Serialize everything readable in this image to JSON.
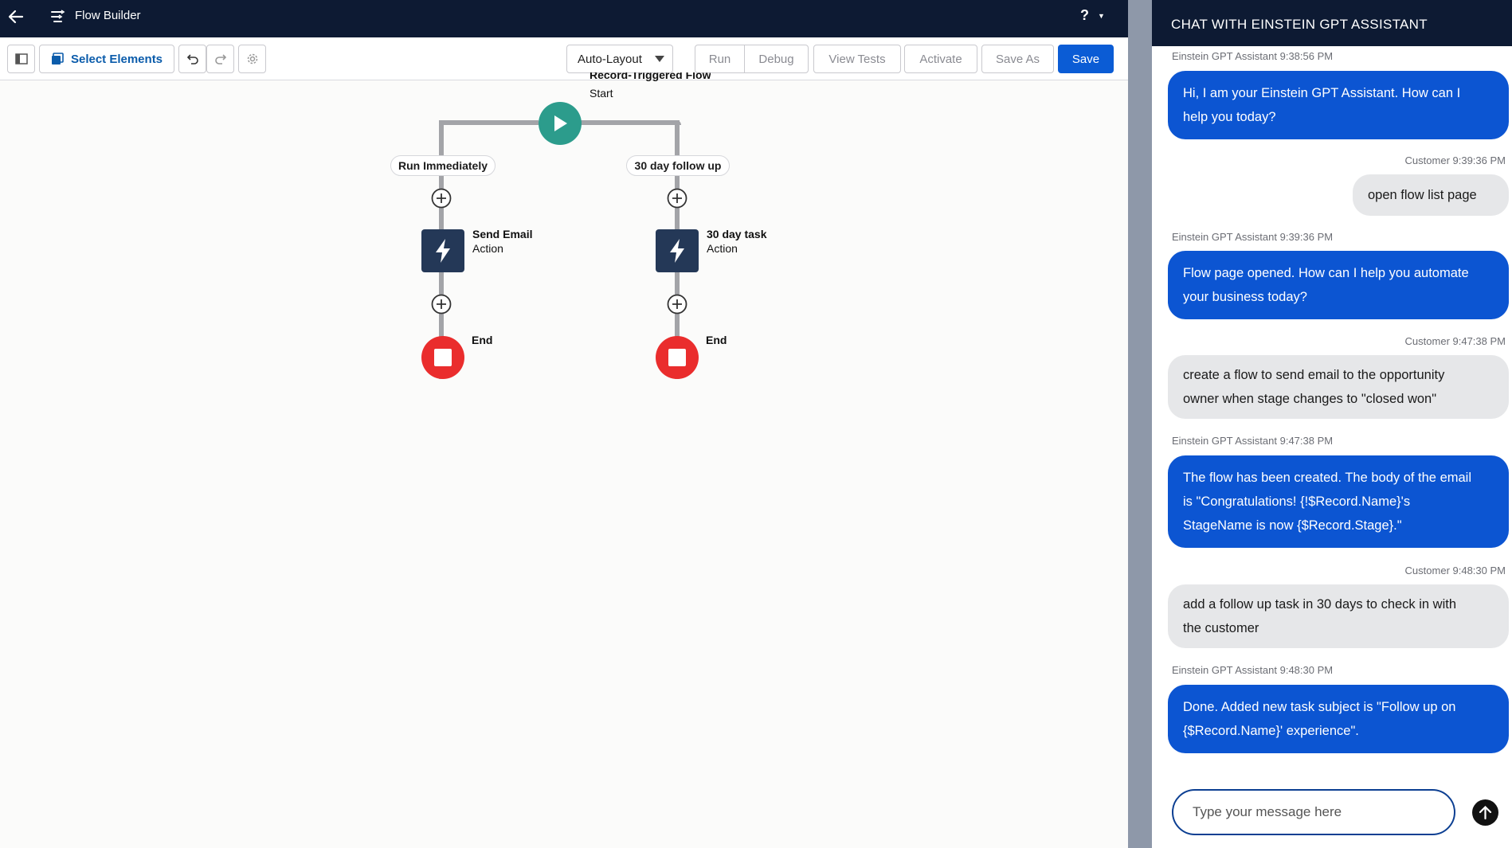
{
  "header": {
    "app_title": "Flow Builder",
    "help_label": "?"
  },
  "toolbar": {
    "select_elements_label": "Select Elements",
    "layout_select": "Auto-Layout",
    "run_label": "Run",
    "debug_label": "Debug",
    "view_tests_label": "View Tests",
    "activate_label": "Activate",
    "save_as_label": "Save As",
    "save_label": "Save"
  },
  "flow": {
    "start": {
      "title": "Record-Triggered Flow",
      "subtitle": "Start"
    },
    "branches": [
      {
        "label": "Run Immediately",
        "action_title": "Send Email",
        "action_type": "Action",
        "end_label": "End"
      },
      {
        "label": "30 day follow up",
        "action_title": "30 day task",
        "action_type": "Action",
        "end_label": "End"
      }
    ]
  },
  "chat": {
    "title": "CHAT WITH EINSTEIN GPT ASSISTANT",
    "messages": [
      {
        "role": "assistant",
        "meta": "Einstein GPT Assistant 9:38:56 PM",
        "lines": [
          "Hi, I am your Einstein GPT Assistant. How can I",
          "help you today?"
        ]
      },
      {
        "role": "customer",
        "meta": "Customer 9:39:36 PM",
        "lines": [
          "open flow list page"
        ]
      },
      {
        "role": "assistant",
        "meta": "Einstein GPT Assistant 9:39:36 PM",
        "lines": [
          "Flow page opened. How can I help you automate",
          "your business today?"
        ]
      },
      {
        "role": "customer",
        "meta": "Customer 9:47:38 PM",
        "lines": [
          "create a flow to send email to the opportunity",
          "owner when stage changes to \"closed won\""
        ]
      },
      {
        "role": "assistant",
        "meta": "Einstein GPT Assistant 9:47:38 PM",
        "lines": [
          "The flow has been created. The body of the email",
          "is \"Congratulations! {!$Record.Name}'s",
          "StageName is now {$Record.Stage}.\""
        ]
      },
      {
        "role": "customer",
        "meta": "Customer 9:48:30 PM",
        "lines": [
          "add a follow up task in 30 days to check in with",
          "the customer"
        ]
      },
      {
        "role": "assistant",
        "meta": "Einstein GPT Assistant 9:48:30 PM",
        "lines": [
          "Done. Added new task subject is \"Follow up on",
          "{$Record.Name}' experience\"."
        ]
      }
    ],
    "input_placeholder": "Type your message here"
  },
  "colors": {
    "topbar": "#0d1a33",
    "primary": "#0b5cd5",
    "action": "#243857",
    "end": "#ea2d2d",
    "start": "#2c9c8c",
    "bot_bubble": "#0c55d2",
    "user_bubble": "#e6e7e9"
  },
  "icons": [
    "back-arrow-icon",
    "flow-builder-icon",
    "help-icon",
    "panel-toggle-icon",
    "select-elements-icon",
    "undo-icon",
    "redo-icon",
    "settings-icon",
    "chevron-down-icon",
    "play-icon",
    "lightning-icon",
    "add-element-icon",
    "stop-icon",
    "send-icon"
  ]
}
